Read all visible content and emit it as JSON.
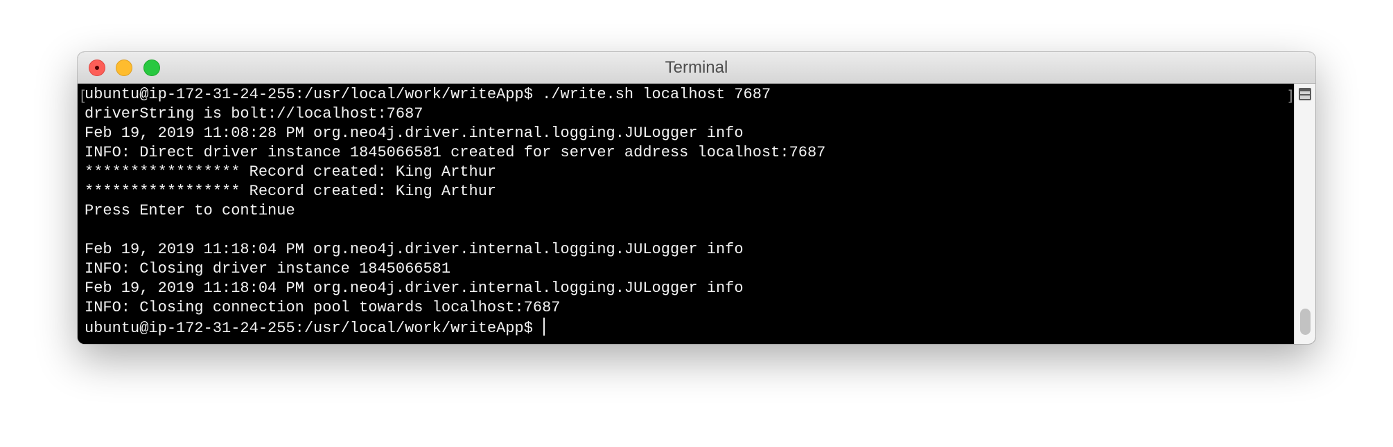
{
  "window": {
    "title": "Terminal"
  },
  "terminal": {
    "lines": [
      "ubuntu@ip-172-31-24-255:/usr/local/work/writeApp$ ./write.sh localhost 7687",
      "driverString is bolt://localhost:7687",
      "Feb 19, 2019 11:08:28 PM org.neo4j.driver.internal.logging.JULogger info",
      "INFO: Direct driver instance 1845066581 created for server address localhost:7687",
      "***************** Record created: King Arthur",
      "***************** Record created: King Arthur",
      "Press Enter to continue",
      "",
      "Feb 19, 2019 11:18:04 PM org.neo4j.driver.internal.logging.JULogger info",
      "INFO: Closing driver instance 1845066581",
      "Feb 19, 2019 11:18:04 PM org.neo4j.driver.internal.logging.JULogger info",
      "INFO: Closing connection pool towards localhost:7687",
      "ubuntu@ip-172-31-24-255:/usr/local/work/writeApp$ "
    ],
    "mark_left": "[",
    "mark_right": "]"
  },
  "colors": {
    "background": "#000000",
    "text": "#f2f2f2",
    "close": "#fd5e57",
    "minimize": "#febc2e",
    "zoom": "#28c840"
  },
  "icons": [
    "close-icon",
    "minimize-icon",
    "zoom-icon",
    "split-pane-icon"
  ]
}
